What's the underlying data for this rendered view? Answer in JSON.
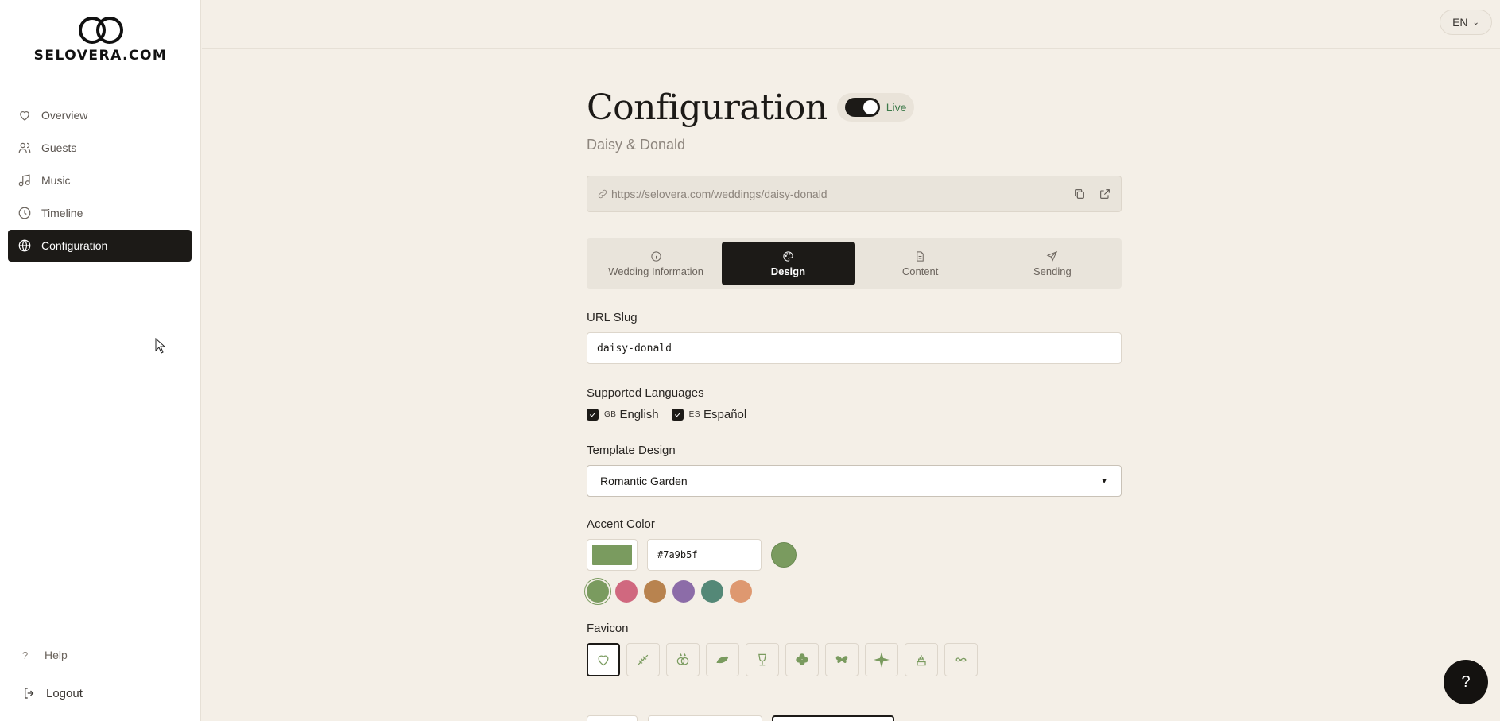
{
  "brand": {
    "logo_text": "SELOVERA.COM"
  },
  "sidebar": {
    "items": [
      {
        "label": "Overview",
        "icon": "heart-icon"
      },
      {
        "label": "Guests",
        "icon": "users-icon"
      },
      {
        "label": "Music",
        "icon": "music-icon"
      },
      {
        "label": "Timeline",
        "icon": "clock-icon"
      },
      {
        "label": "Configuration",
        "icon": "globe-icon",
        "active": true
      }
    ],
    "help_label": "Help",
    "logout_label": "Logout"
  },
  "topbar": {
    "language": "EN"
  },
  "page": {
    "title": "Configuration",
    "live_label": "Live",
    "subtitle": "Daisy & Donald",
    "url": "https://selovera.com/weddings/daisy-donald"
  },
  "tabs": [
    {
      "label": "Wedding Information",
      "icon": "info-icon"
    },
    {
      "label": "Design",
      "icon": "palette-icon",
      "active": true
    },
    {
      "label": "Content",
      "icon": "document-icon"
    },
    {
      "label": "Sending",
      "icon": "send-icon"
    }
  ],
  "form": {
    "slug_label": "URL Slug",
    "slug_value": "daisy-donald",
    "languages_label": "Supported Languages",
    "languages": [
      {
        "flag": "GB",
        "label": "English",
        "checked": true
      },
      {
        "flag": "ES",
        "label": "Español",
        "checked": true
      }
    ],
    "template_label": "Template Design",
    "template_value": "Romantic Garden",
    "accent_label": "Accent Color",
    "accent_value": "#7a9b5f",
    "accent_presets": [
      "#7a9b5f",
      "#d0687f",
      "#b8834f",
      "#8c6ca8",
      "#548877",
      "#de9870"
    ],
    "favicon_label": "Favicon",
    "favicons": [
      "heart-icon",
      "branch-icon",
      "rings-icon",
      "leaf-icon",
      "goblet-icon",
      "clover-icon",
      "butterfly-icon",
      "sparkle-icon",
      "cake-icon",
      "infinity-icon"
    ]
  },
  "help_fab": "?"
}
